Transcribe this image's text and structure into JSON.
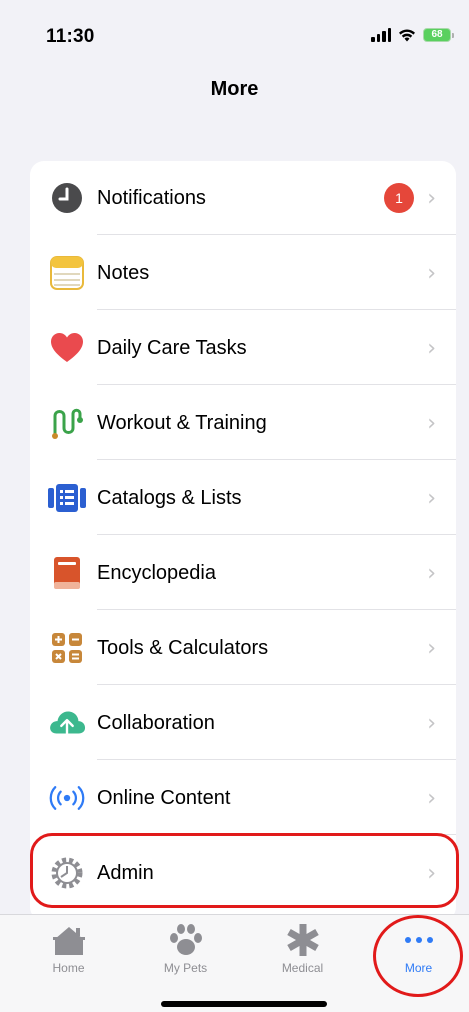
{
  "status_bar": {
    "time": "11:30",
    "battery": "68"
  },
  "nav": {
    "title": "More"
  },
  "menu": {
    "items": [
      {
        "label": "Notifications",
        "badge": "1"
      },
      {
        "label": "Notes"
      },
      {
        "label": "Daily Care Tasks"
      },
      {
        "label": "Workout & Training"
      },
      {
        "label": "Catalogs & Lists"
      },
      {
        "label": "Encyclopedia"
      },
      {
        "label": "Tools & Calculators"
      },
      {
        "label": "Collaboration"
      },
      {
        "label": "Online Content"
      },
      {
        "label": "Admin"
      }
    ]
  },
  "tabs": [
    {
      "label": "Home",
      "icon": "house-icon"
    },
    {
      "label": "My Pets",
      "icon": "paw-icon"
    },
    {
      "label": "Medical",
      "icon": "asterisk-icon"
    },
    {
      "label": "More",
      "icon": "more-dots-icon",
      "active": true
    }
  ],
  "colors": {
    "accent": "#2f7bf6",
    "badge": "#e5473a",
    "highlight": "#e11a1a"
  }
}
